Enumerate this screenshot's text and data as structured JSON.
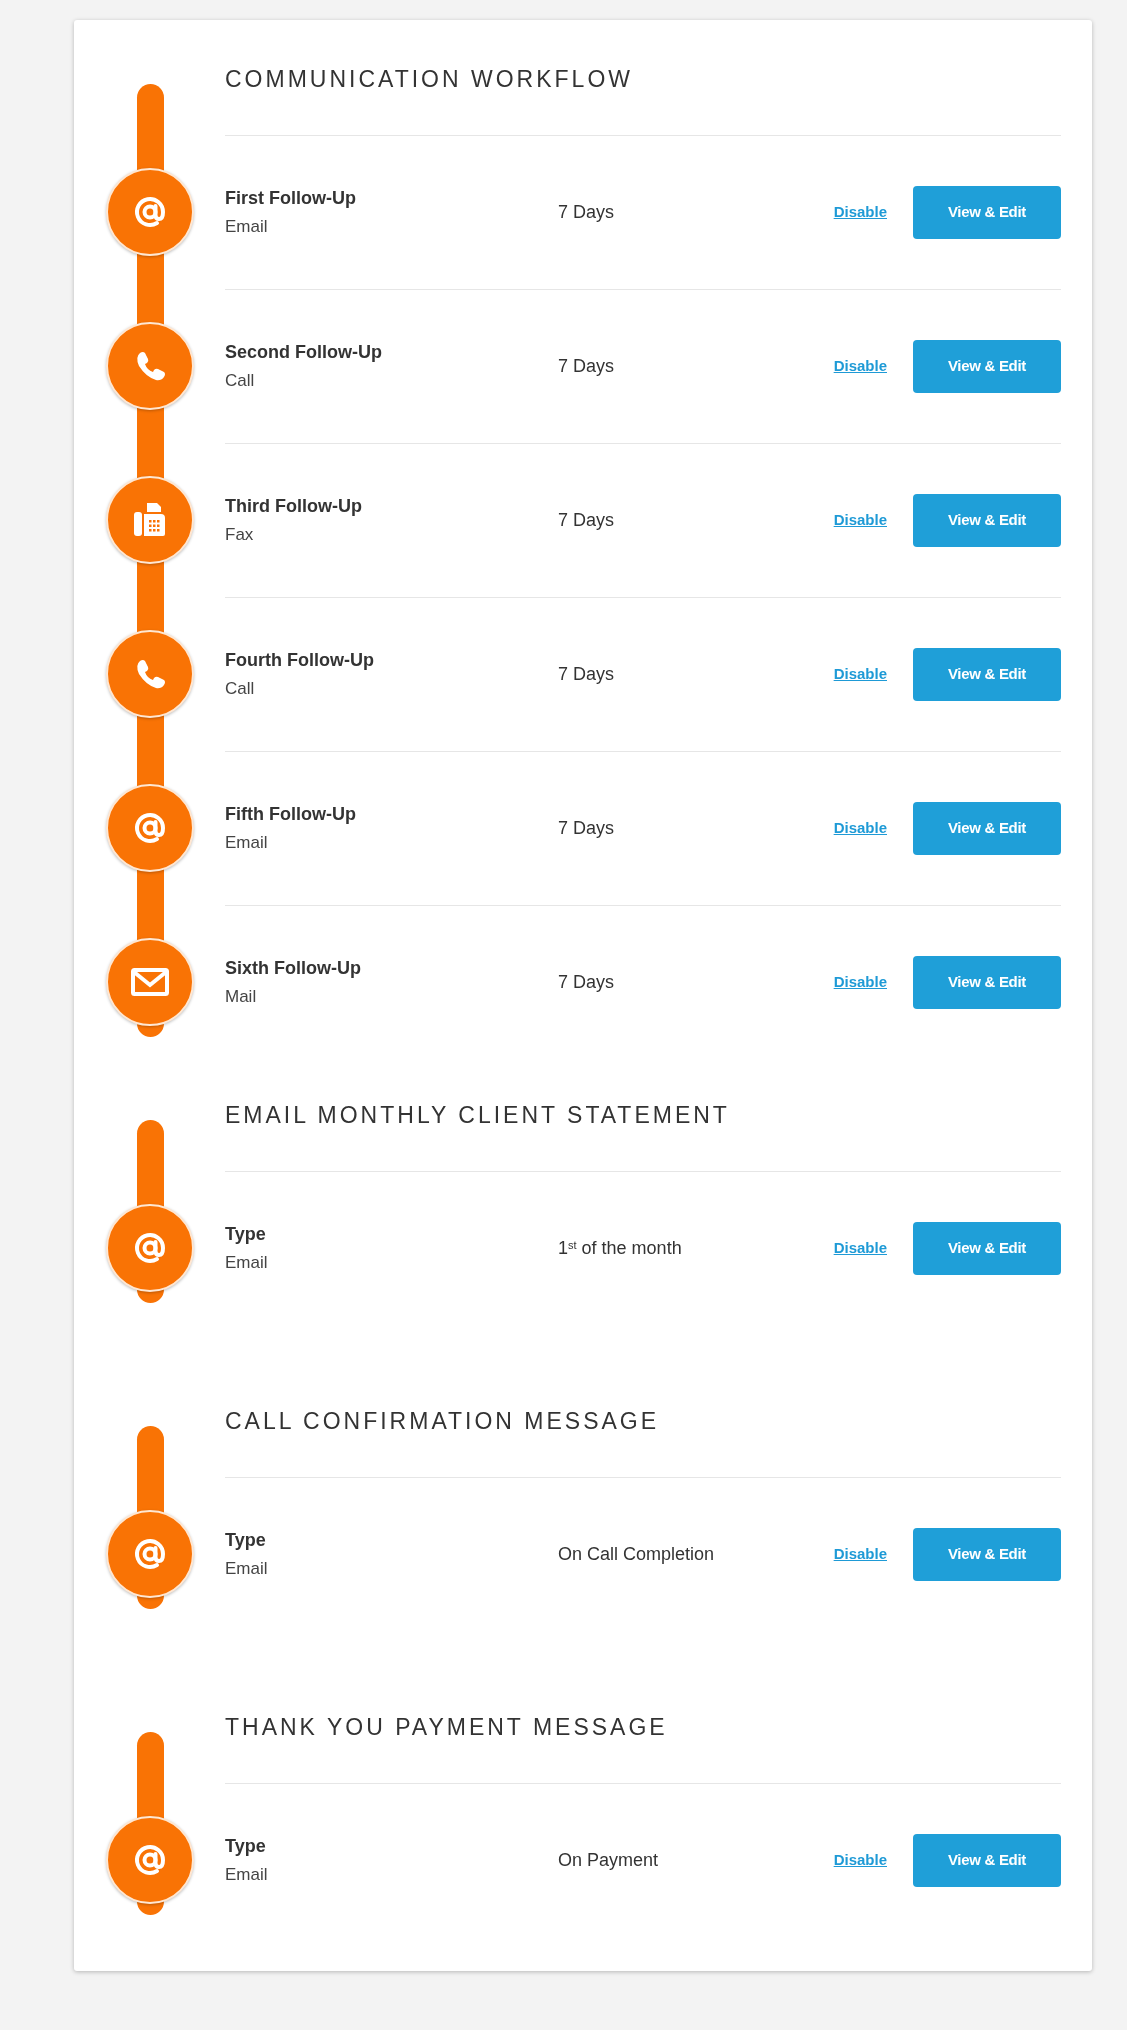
{
  "sections": [
    {
      "title": "COMMUNICATION WORKFLOW",
      "items": [
        {
          "kind": "email",
          "title": "First Follow-Up",
          "channel": "Email",
          "timing": "7 Days",
          "link": "Disable",
          "button": "View & Edit"
        },
        {
          "kind": "call",
          "title": "Second Follow-Up",
          "channel": "Call",
          "timing": "7 Days",
          "link": "Disable",
          "button": "View & Edit"
        },
        {
          "kind": "fax",
          "title": "Third Follow-Up",
          "channel": "Fax",
          "timing": "7 Days",
          "link": "Disable",
          "button": "View & Edit"
        },
        {
          "kind": "call",
          "title": "Fourth Follow-Up",
          "channel": "Call",
          "timing": "7 Days",
          "link": "Disable",
          "button": "View & Edit"
        },
        {
          "kind": "email",
          "title": "Fifth Follow-Up",
          "channel": "Email",
          "timing": "7 Days",
          "link": "Disable",
          "button": "View & Edit"
        },
        {
          "kind": "mail",
          "title": "Sixth Follow-Up",
          "channel": "Mail",
          "timing": "7 Days",
          "link": "Disable",
          "button": "View & Edit"
        }
      ]
    },
    {
      "title": "EMAIL MONTHLY CLIENT STATEMENT",
      "items": [
        {
          "kind": "email",
          "title": "Type",
          "channel": "Email",
          "timing": "1$^{st}$ of the month",
          "link": "Disable",
          "button": "View & Edit"
        }
      ]
    },
    {
      "title": "CALL CONFIRMATION MESSAGE",
      "items": [
        {
          "kind": "email",
          "title": "Type",
          "channel": "Email",
          "timing": "On Call Completion",
          "link": "Disable",
          "button": "View & Edit"
        }
      ]
    },
    {
      "title": "THANK YOU PAYMENT MESSAGE",
      "items": [
        {
          "kind": "email",
          "title": "Type",
          "channel": "Email",
          "timing": "On Payment",
          "link": "Disable",
          "button": "View & Edit"
        }
      ]
    }
  ]
}
